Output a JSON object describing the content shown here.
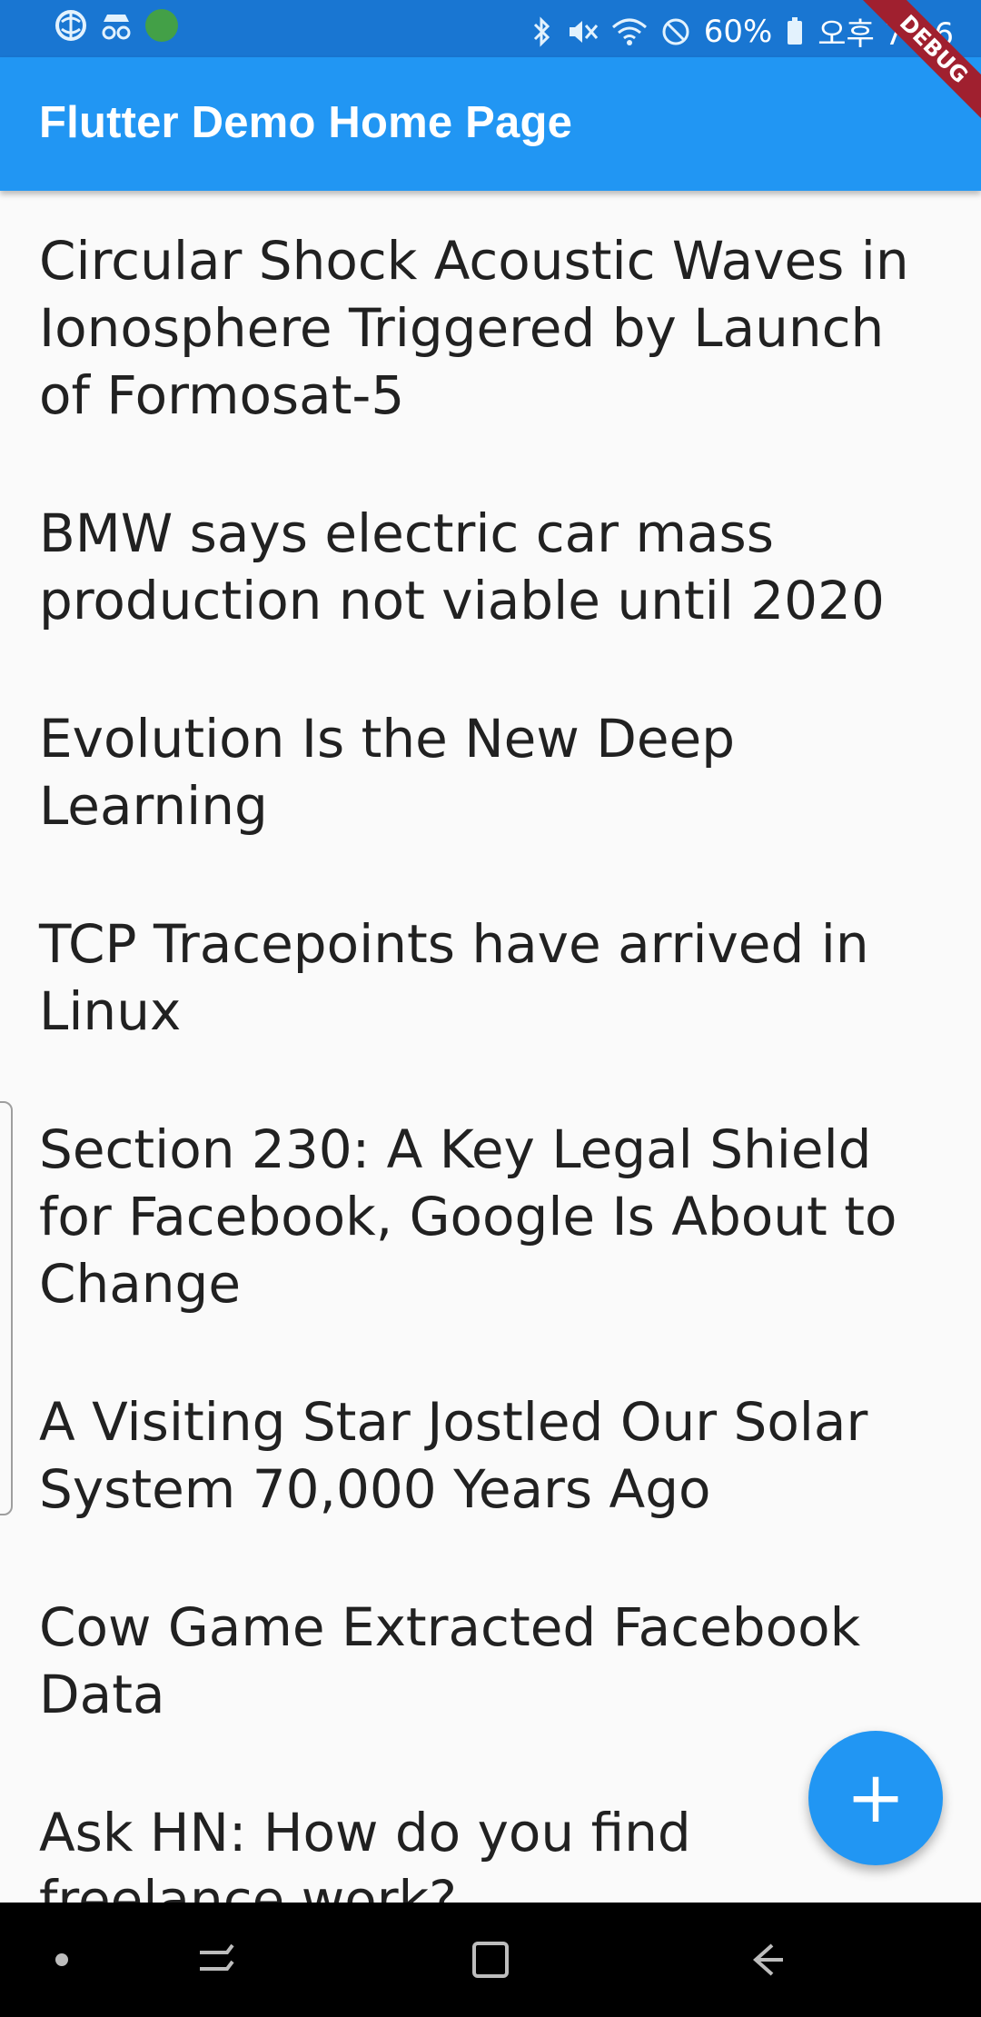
{
  "status_bar": {
    "battery": "60%",
    "time": "오후 7:06",
    "left_icons": [
      "globe-icon",
      "incognito-icon",
      "green-app-icon"
    ],
    "right_icons": [
      "bluetooth-icon",
      "mute-icon",
      "wifi-icon",
      "do-not-disturb-icon",
      "battery-icon"
    ]
  },
  "app_bar": {
    "title": "Flutter Demo Home Page",
    "background": "#2196f3"
  },
  "debug_banner": "DEBUG",
  "list": {
    "items": [
      "Circular Shock Acoustic Waves in Ionosphere Triggered by Launch of Formosat-5",
      "BMW says electric car mass production not viable until 2020",
      "Evolution Is the New Deep Learning",
      "TCP Tracepoints have arrived in Linux",
      "Section 230: A Key Legal Shield for Facebook, Google Is About to Change",
      "A Visiting Star Jostled Our Solar System 70,000 Years Ago",
      "Cow Game Extracted Facebook Data",
      "Ask HN: How do you find freelance work?"
    ]
  },
  "fab": {
    "icon": "plus-icon",
    "label": "+"
  },
  "nav_bar": {
    "icons": [
      "dot-icon",
      "recents-icon",
      "home-icon",
      "back-icon"
    ]
  }
}
